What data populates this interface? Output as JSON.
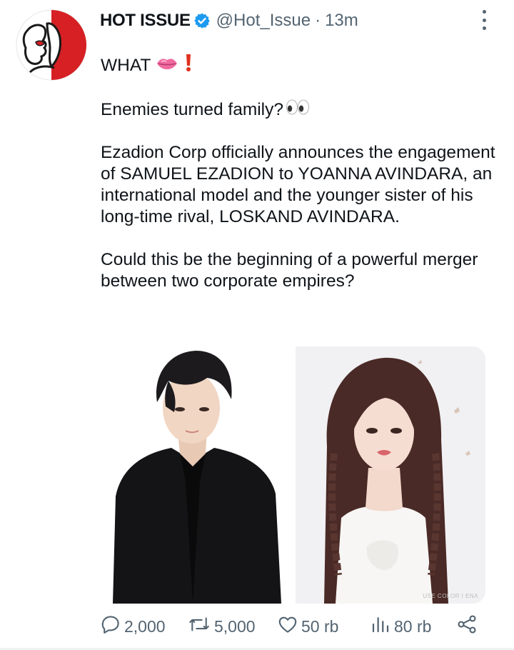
{
  "tweet": {
    "display_name": "HOT ISSUE",
    "handle": "@Hot_Issue",
    "separator": "·",
    "time": "13m",
    "verified": true,
    "line1_text": "WHAT",
    "line1_emojis": [
      "lips-emoji",
      "red-exclamation-emoji"
    ],
    "line2_text": "Enemies turned family?",
    "line2_emoji": "eyes-emoji",
    "paragraph3": "Ezadion Corp officially announces the engagement of SAMUEL EZADION to YOANNA AVINDARA, an international model and the younger sister of his long-time rival, LOSKAND AVINDARA.",
    "paragraph4": "Could this be the beginning of a powerful merger between two corporate empires?",
    "media_watermark": "USE COLOR I ENA"
  },
  "actions": {
    "reply_count": "2,000",
    "retweet_count": "5,000",
    "like_count": "50 rb",
    "views_count": "80 rb"
  },
  "colors": {
    "text": "#0f1419",
    "secondary": "#536471",
    "verified": "#1d9bf0",
    "avatar_red": "#d62024"
  }
}
